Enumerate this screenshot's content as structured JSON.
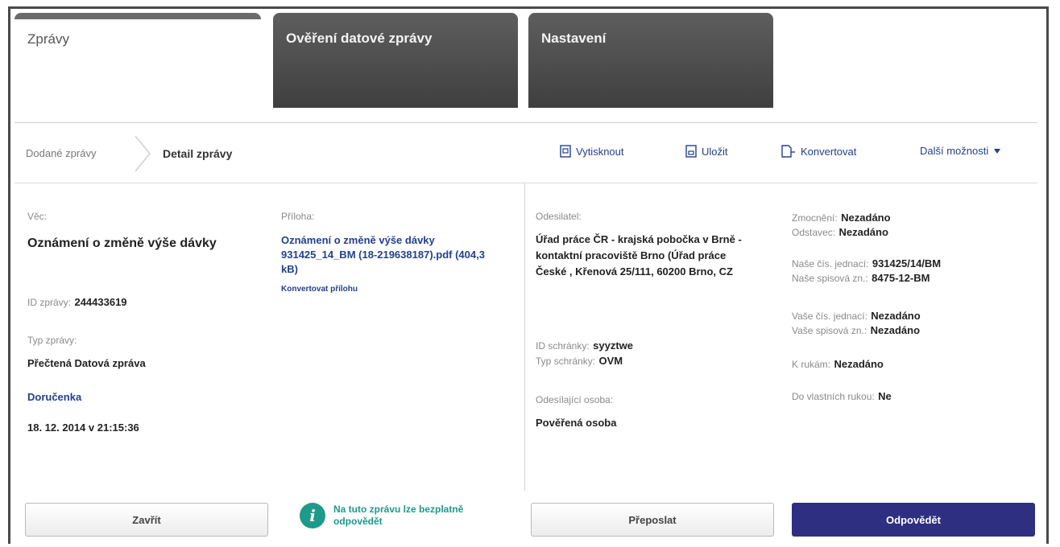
{
  "tabs": [
    {
      "label": "Zprávy",
      "active": true
    },
    {
      "label": "Ověření datové zprávy",
      "active": false
    },
    {
      "label": "Nastavení",
      "active": false
    }
  ],
  "breadcrumb": {
    "home": "Dodané zprávy",
    "current": "Detail zprávy"
  },
  "toolbar": {
    "print": "Vytisknout",
    "save": "Uložit",
    "convert": "Konvertovat",
    "more": "Další možnosti"
  },
  "message": {
    "subject_label": "Věc:",
    "subject": "Oznámení o změně výše dávky",
    "id_label": "ID zprávy:",
    "id": "244433619",
    "type_label": "Typ zprávy:",
    "type": "Přečtená Datová zpráva",
    "receipt_link": "Doručenka",
    "date": "18. 12. 2014 v 21:15:36"
  },
  "attachment": {
    "label": "Příloha:",
    "file": "Oznámení o změně výše dávky 931425_14_BM (18-219638187).pdf (404,3 kB)",
    "convert": "Konvertovat přílohu"
  },
  "sender": {
    "label": "Odesilatel:",
    "name": "Úřad práce ČR - krajská pobočka v Brně - kontaktní pracoviště Brno (Úřad práce České , Křenová 25/111, 60200 Brno, CZ",
    "box_id_label": "ID schránky:",
    "box_id": "syyztwe",
    "box_type_label": "Typ schránky:",
    "box_type": "OVM",
    "person_label": "Odesílající osoba:",
    "person": "Pověřená osoba"
  },
  "details": {
    "authorization_label": "Zmocnění:",
    "authorization": "Nezadáno",
    "paragraph_label": "Odstavec:",
    "paragraph": "Nezadáno",
    "our_ref_label": "Naše čís. jednací:",
    "our_ref": "931425/14/BM",
    "our_file_label": "Naše spisová zn.:",
    "our_file": "8475-12-BM",
    "your_ref_label": "Vaše čís. jednací:",
    "your_ref": "Nezadáno",
    "your_file_label": "Vaše spisová zn.:",
    "your_file": "Nezadáno",
    "attention_label": "K rukám:",
    "attention": "Nezadáno",
    "own_hands_label": "Do vlastních rukou:",
    "own_hands": "Ne"
  },
  "buttons": {
    "close": "Zavřít",
    "forward": "Přeposlat",
    "reply": "Odpovědět"
  },
  "info": {
    "icon": "info-icon",
    "text": "Na tuto zprávu lze bezplatně odpovědět"
  },
  "colors": {
    "accent": "#24408e",
    "reply_button": "#2e2f80",
    "info_teal": "#1e9a8a",
    "tab_dark": "#4a4a4a"
  }
}
